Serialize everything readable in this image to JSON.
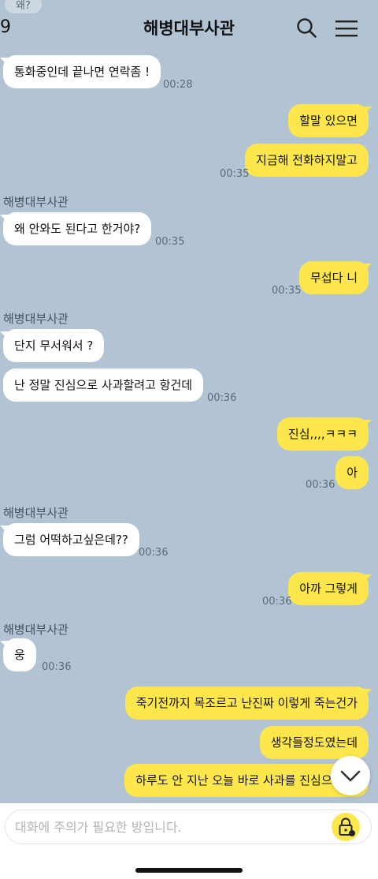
{
  "header": {
    "partial_time": "9",
    "ghost_text": "왜?",
    "title": "해병대부사관",
    "search_icon": "search-icon",
    "menu_icon": "hamburger-menu-icon"
  },
  "messages": [
    {
      "side": "in",
      "text": "통화중인데 끝나면 연락좀 !",
      "time": "00:28"
    },
    {
      "side": "out",
      "text": "할말 있으면"
    },
    {
      "side": "out",
      "text": "지금해 전화하지말고",
      "time": "00:35"
    },
    {
      "sender": "해병대부사관",
      "side": "in",
      "text": "왜 안와도 된다고 한거야?",
      "time": "00:35"
    },
    {
      "side": "out",
      "text": "무섭다 니",
      "time": "00:35"
    },
    {
      "sender": "해병대부사관",
      "side": "in",
      "text": "단지 무서워서 ?"
    },
    {
      "side": "in",
      "text": "난 정말 진심으로 사과할려고 항건데",
      "time": "00:36"
    },
    {
      "side": "out",
      "text": "진심,,,,ㅋㅋㅋ"
    },
    {
      "side": "out",
      "text": "아",
      "time": "00:36"
    },
    {
      "sender": "해병대부사관",
      "side": "in",
      "text": "그럼 어떡하고싶은데??",
      "time": "00:36"
    },
    {
      "side": "out",
      "text": "아까 그렇게",
      "time": "00:36"
    },
    {
      "sender": "해병대부사관",
      "side": "in",
      "text": "웅",
      "time": "00:36"
    },
    {
      "side": "out",
      "text": "죽기전까지 목조르고 난진짜 이렇게 죽는건가"
    },
    {
      "side": "out",
      "text": "생각들정도였는데"
    },
    {
      "side": "out",
      "text": "하루도 안 지난 오늘 바로 사과를 진심으로 하"
    }
  ],
  "input": {
    "placeholder": "대화에 주의가 필요한 방입니다."
  },
  "icons": {
    "scroll_down": "chevron-down-icon",
    "lock": "lock-icon"
  },
  "colors": {
    "background": "#b2c3d4",
    "incoming_bubble": "#ffffff",
    "outgoing_bubble": "#fde74c"
  }
}
